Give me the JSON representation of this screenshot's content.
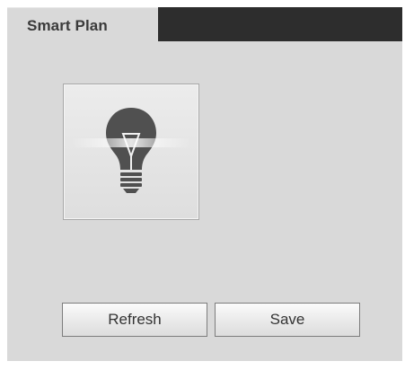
{
  "tabs": [
    {
      "label": "Smart Plan",
      "active": true
    }
  ],
  "smart_plan": {
    "tile_icon": "light-bulb-icon"
  },
  "actions": {
    "refresh_label": "Refresh",
    "save_label": "Save"
  },
  "colors": {
    "panel_background": "#d9d9d9",
    "tab_strip": "#2d2d2d",
    "icon_dark": "#505050"
  }
}
